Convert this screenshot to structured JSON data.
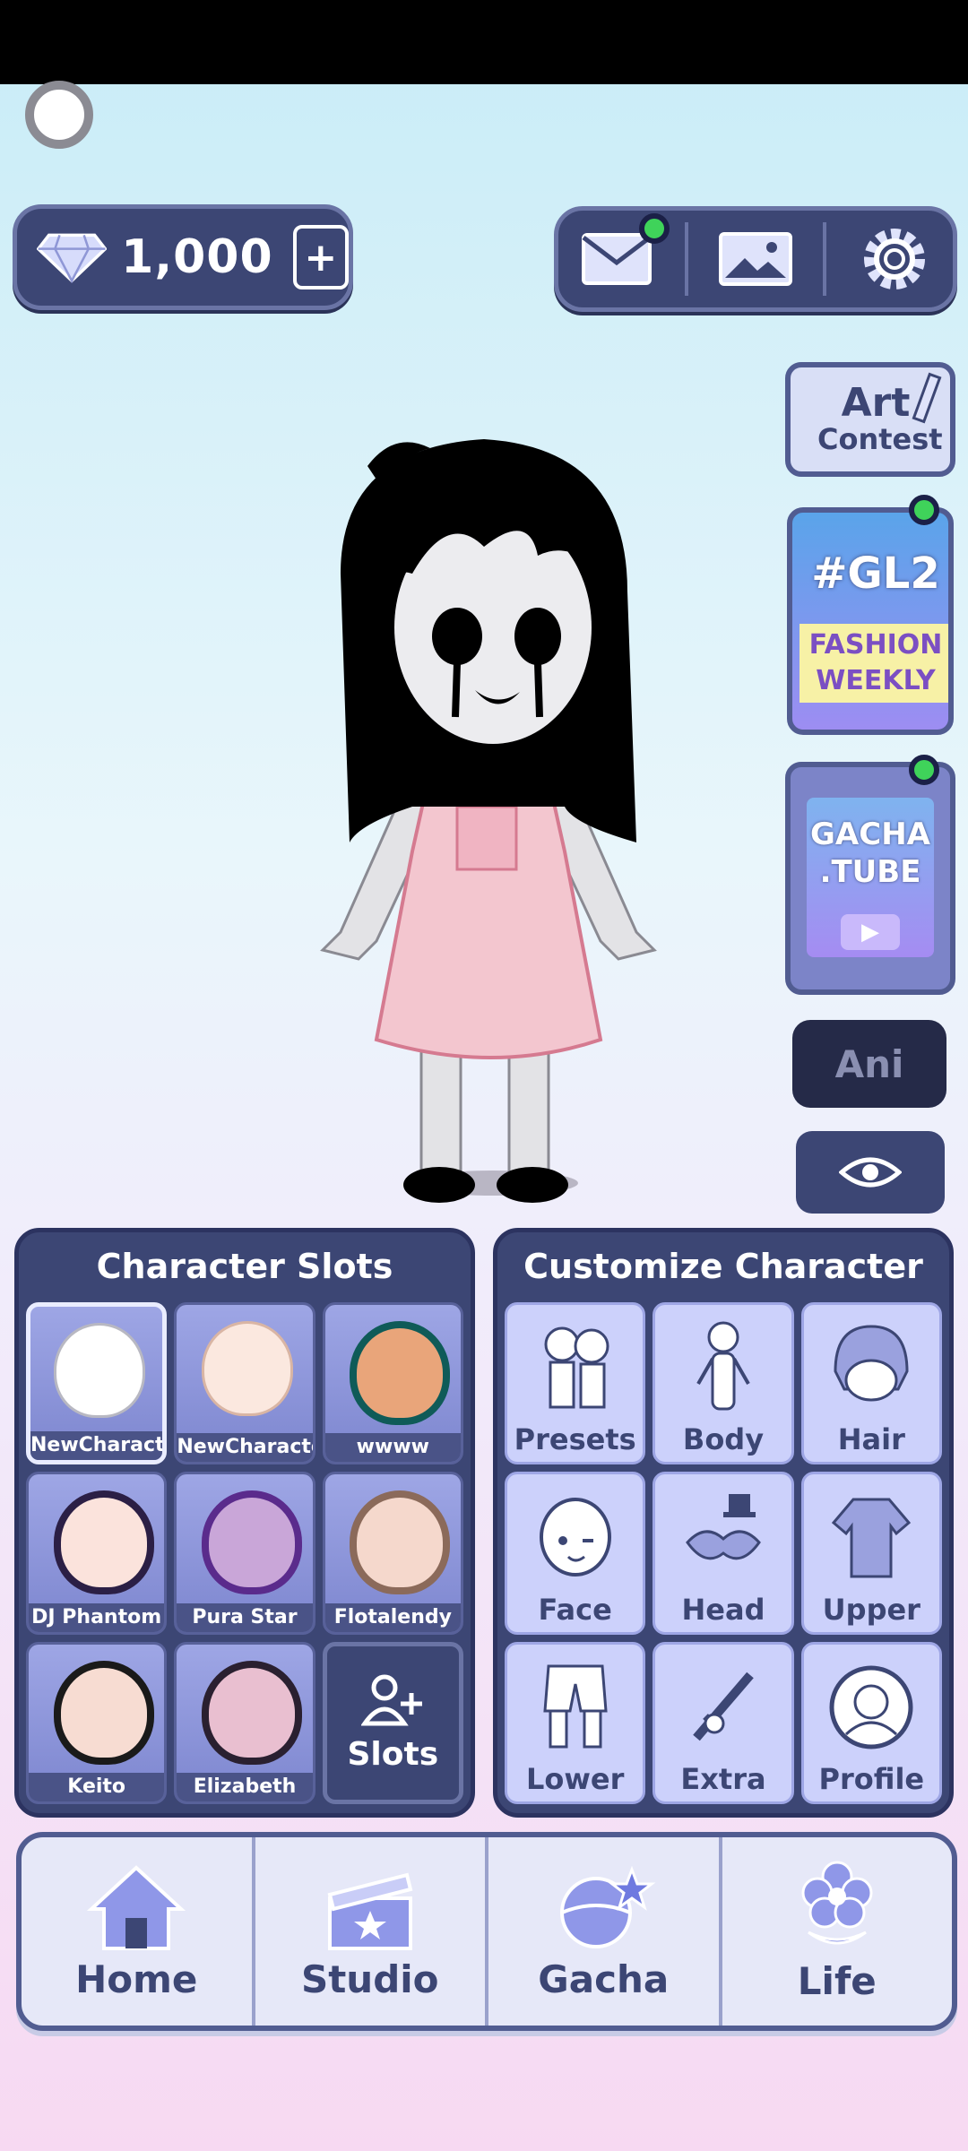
{
  "currency": {
    "amount": "1,000",
    "icon": "diamond-icon"
  },
  "top_buttons": [
    {
      "name": "mail",
      "icon": "mail-icon"
    },
    {
      "name": "gallery",
      "icon": "image-icon"
    },
    {
      "name": "settings",
      "icon": "gear-icon"
    }
  ],
  "side": {
    "art_contest": {
      "line1": "Art",
      "line2": "Contest"
    },
    "gl2": {
      "tag": "#GL2",
      "line1": "FASHION",
      "line2": "WEEKLY"
    },
    "gacha_tube": {
      "line1": "GACHA",
      "line2": ".TUBE"
    },
    "ani_label": "Ani"
  },
  "slots_panel": {
    "title": "Character Slots",
    "slots": [
      {
        "label": "NewCharacte"
      },
      {
        "label": "NewCharacter"
      },
      {
        "label": "wwww"
      },
      {
        "label": "DJ Phantom"
      },
      {
        "label": "Pura Star"
      },
      {
        "label": "Flotalendy"
      },
      {
        "label": "Keito"
      },
      {
        "label": "Elizabeth"
      }
    ],
    "add_label": "Slots"
  },
  "customize_panel": {
    "title": "Customize Character",
    "items": [
      {
        "label": "Presets"
      },
      {
        "label": "Body"
      },
      {
        "label": "Hair"
      },
      {
        "label": "Face"
      },
      {
        "label": "Head"
      },
      {
        "label": "Upper"
      },
      {
        "label": "Lower"
      },
      {
        "label": "Extra"
      },
      {
        "label": "Profile"
      }
    ]
  },
  "nav": [
    {
      "label": "Home",
      "icon": "house-icon"
    },
    {
      "label": "Studio",
      "icon": "clapperboard-icon"
    },
    {
      "label": "Gacha",
      "icon": "gacha-capsule-icon"
    },
    {
      "label": "Life",
      "icon": "flower-icon"
    }
  ],
  "colors": {
    "panel": "#3c4674",
    "notify": "#3fd35a",
    "nav_bg": "#e6e8f8"
  }
}
